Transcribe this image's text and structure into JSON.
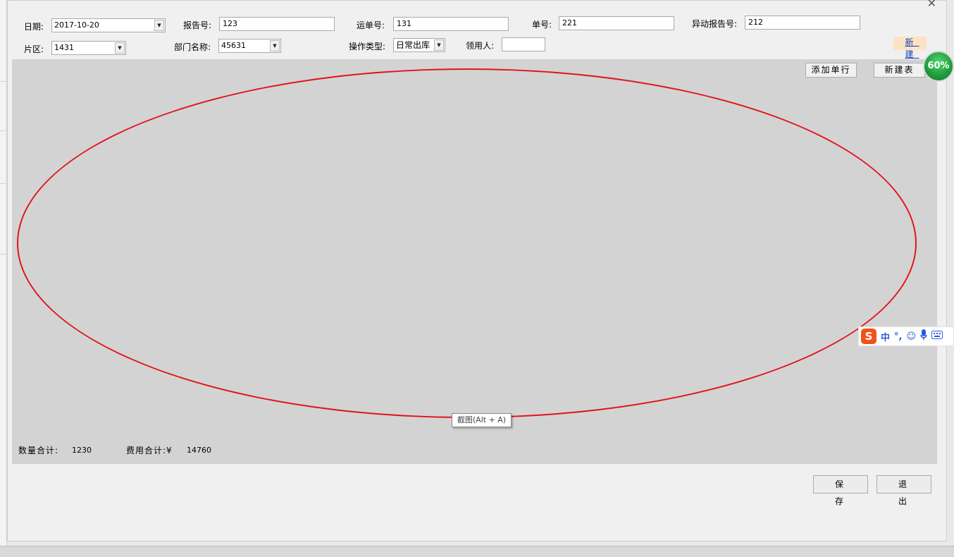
{
  "form": {
    "date_label": "日期:",
    "date_value": "2017-10-20",
    "report_no_label": "报告号:",
    "report_no_value": "123",
    "waybill_label": "运单号:",
    "waybill_value": "131",
    "order_no_label": "单号:",
    "order_no_value": "221",
    "abnormal_label": "异动报告号:",
    "abnormal_value": "212",
    "area_label": "片区:",
    "area_value": "1431",
    "dept_label": "部门名称:",
    "dept_value": "45631",
    "op_type_label": "操作类型:",
    "op_type_value": "日常出库",
    "receiver_label": "领用人:",
    "receiver_value": ""
  },
  "new_link": "新 建",
  "grid": {
    "add_row_button": "添加单行",
    "new_table_button": "新建表",
    "tooltip": "截图(Alt + A)",
    "qty_total_label": "数量合计:",
    "qty_total_value": "1230",
    "cost_total_label": "费用合计:¥",
    "cost_total_value": "14760"
  },
  "actions": {
    "save": "保 存",
    "exit": "退 出"
  },
  "badge": "60%",
  "ime": {
    "logo": "S",
    "lang": "中",
    "punct": "°,",
    "emoji_icon": "smiley-icon",
    "mic_icon": "microphone-icon",
    "keyboard_icon": "keyboard-icon"
  },
  "colors": {
    "annotation_red": "#e0141b",
    "link_blue": "#1a3fb5",
    "badge_green": "#1f9a3a",
    "ime_orange": "#f2511a"
  }
}
